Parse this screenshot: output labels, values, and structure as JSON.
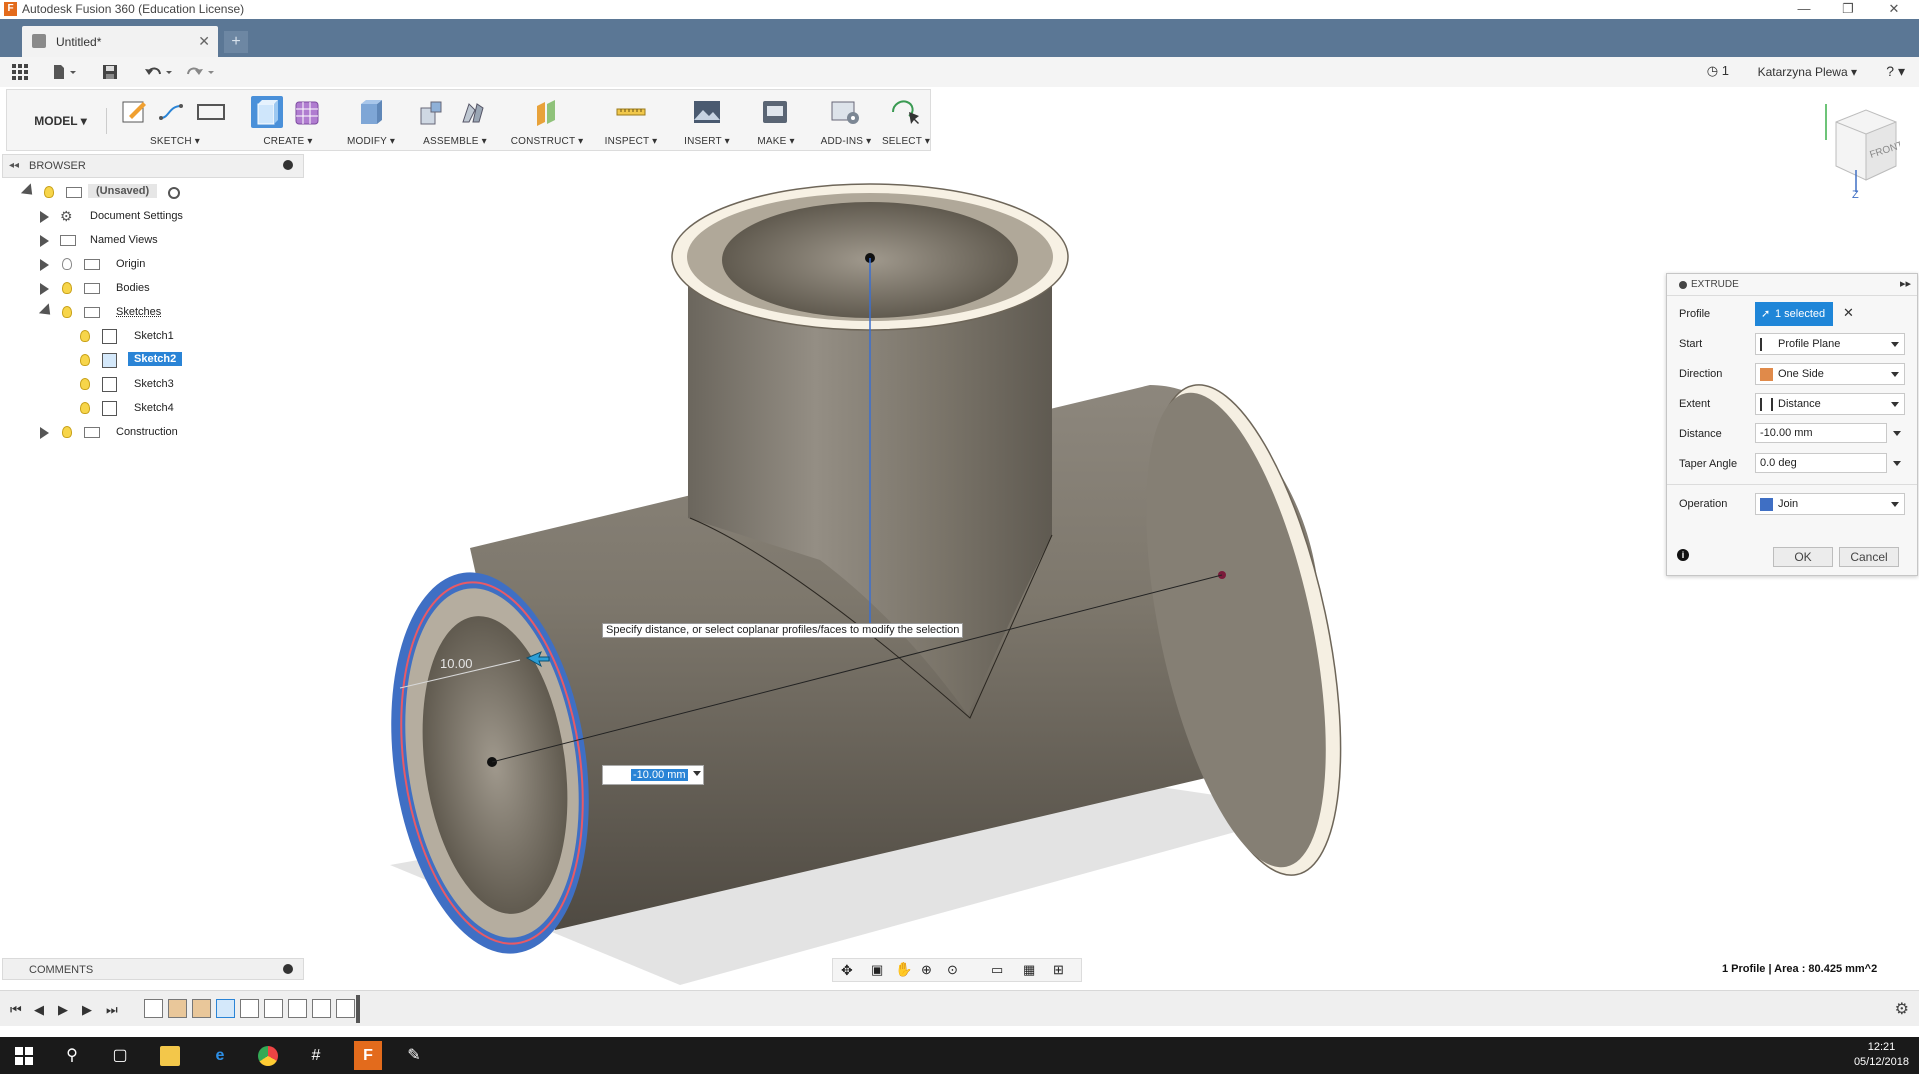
{
  "window": {
    "app_title": "Autodesk Fusion 360 (Education License)",
    "app_icon_glyph": "F",
    "min_glyph": "—",
    "restore_glyph": "❐",
    "close_glyph": "✕"
  },
  "tab": {
    "doc_name": "Untitled*",
    "close_glyph": "✕",
    "new_tab_glyph": "+"
  },
  "quick_access": {
    "jobs_count": "1",
    "user_name": "Katarzyna Plewa ▾",
    "help_glyph": "? ▾"
  },
  "toolbar": {
    "workspace": "MODEL ▾",
    "groups": [
      {
        "label": "SKETCH ▾"
      },
      {
        "label": "CREATE ▾"
      },
      {
        "label": "MODIFY ▾"
      },
      {
        "label": "ASSEMBLE ▾"
      },
      {
        "label": "CONSTRUCT ▾"
      },
      {
        "label": "INSPECT ▾"
      },
      {
        "label": "INSERT ▾"
      },
      {
        "label": "MAKE ▾"
      },
      {
        "label": "ADD-INS ▾"
      },
      {
        "label": "SELECT ▾"
      }
    ]
  },
  "browser": {
    "title": "BROWSER",
    "root": "(Unsaved)",
    "items": [
      {
        "label": "Document Settings"
      },
      {
        "label": "Named Views"
      },
      {
        "label": "Origin"
      },
      {
        "label": "Bodies"
      },
      {
        "label": "Sketches"
      },
      {
        "label": "Sketch1"
      },
      {
        "label": "Sketch2"
      },
      {
        "label": "Sketch3"
      },
      {
        "label": "Sketch4"
      },
      {
        "label": "Construction"
      }
    ]
  },
  "viewcube": {
    "face_label": "FRONT",
    "axis_z": "Z"
  },
  "viewport": {
    "tooltip": "Specify distance, or select coplanar profiles/faces to modify the selection",
    "dimension_label": "10.00",
    "distance_input": "-10.00 mm"
  },
  "extrude": {
    "title": "EXTRUDE",
    "rows": [
      {
        "label": "Profile",
        "value": "1 selected"
      },
      {
        "label": "Start",
        "value": "Profile Plane"
      },
      {
        "label": "Direction",
        "value": "One Side"
      },
      {
        "label": "Extent",
        "value": "Distance"
      },
      {
        "label": "Distance",
        "value": "-10.00 mm"
      },
      {
        "label": "Taper Angle",
        "value": "0.0 deg"
      },
      {
        "label": "Operation",
        "value": "Join"
      }
    ],
    "ok": "OK",
    "cancel": "Cancel"
  },
  "comments": {
    "title": "COMMENTS"
  },
  "status": {
    "text": "1 Profile | Area : 80.425 mm^2"
  },
  "taskbar": {
    "time": "12:21",
    "date": "05/12/2018"
  },
  "colors": {
    "accent": "#2a84d6",
    "tabbar": "#5b7795",
    "body": "#7a7469",
    "selected_face": "#3f6fc4"
  }
}
